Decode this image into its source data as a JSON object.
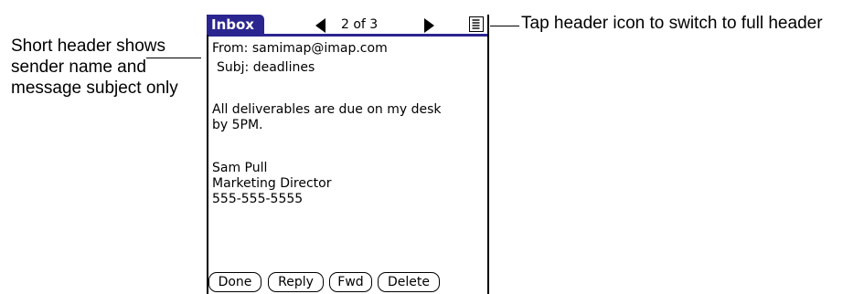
{
  "annotations": {
    "left_callout": "Short header shows sender name and message subject only",
    "right_callout": "Tap header icon to switch to full header"
  },
  "titlebar": {
    "tab_label": "Inbox",
    "page_indicator": "2 of 3",
    "prev_icon": "left-triangle-arrow",
    "next_icon": "right-triangle-arrow",
    "header_toggle_icon": "document-lines-icon",
    "accent_color": "#2b2590"
  },
  "message": {
    "from_label": "From:",
    "from_value": "samimap@imap.com",
    "subject_label": "Subj:",
    "subject_value": "deadlines",
    "body_lines": [
      "All deliverables are due on my desk",
      "by 5PM."
    ],
    "signature_lines": [
      "Sam Pull",
      "Marketing Director",
      "555-555-5555"
    ]
  },
  "buttons": {
    "done": "Done",
    "reply": "Reply",
    "fwd": "Fwd",
    "delete": "Delete"
  }
}
